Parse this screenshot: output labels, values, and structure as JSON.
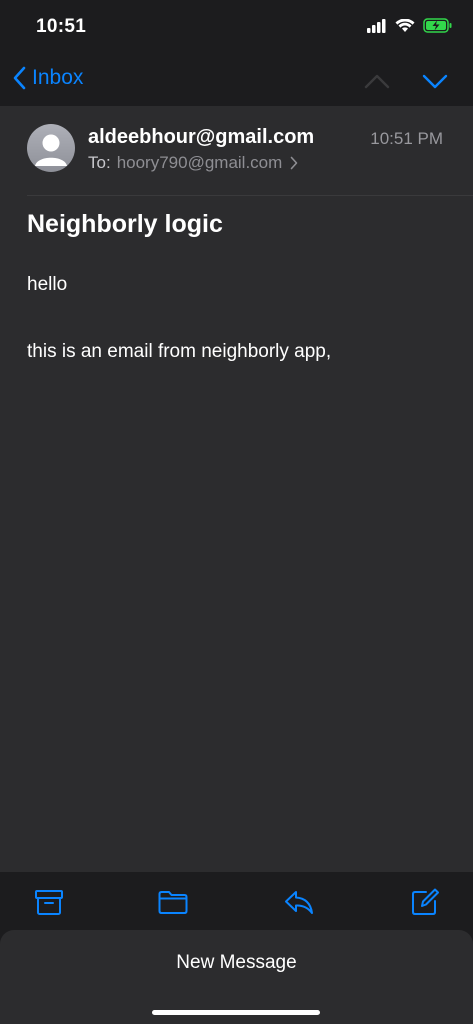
{
  "status_bar": {
    "time": "10:51"
  },
  "nav": {
    "back_label": "Inbox"
  },
  "message": {
    "sender": "aldeebhour@gmail.com",
    "time": "10:51 PM",
    "to_label": "To:",
    "to_address": "hoory790@gmail.com",
    "subject": "Neighborly logic",
    "body_lines": [
      "hello",
      "this is an email from neighborly app,"
    ]
  },
  "toolbar": {
    "icons": [
      "archive-icon",
      "folder-icon",
      "reply-icon",
      "compose-icon"
    ]
  },
  "sheet": {
    "new_message_label": "New Message"
  },
  "colors": {
    "accent": "#0a84ff",
    "background": "#1c1c1e",
    "content_background": "#2c2c2e"
  }
}
